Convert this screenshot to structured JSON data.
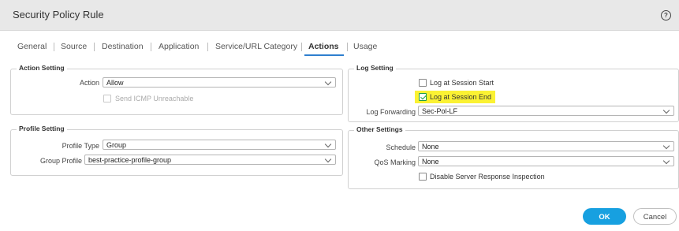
{
  "window": {
    "title": "Security Policy Rule",
    "help_icon": "?"
  },
  "tabs": [
    {
      "label": "General"
    },
    {
      "label": "Source"
    },
    {
      "label": "Destination"
    },
    {
      "label": "Application"
    },
    {
      "label": "Service/URL Category"
    },
    {
      "label": "Actions",
      "active": true
    },
    {
      "label": "Usage"
    }
  ],
  "action_setting": {
    "legend": "Action Setting",
    "action_label": "Action",
    "action_value": "Allow",
    "send_icmp_label": "Send ICMP Unreachable",
    "send_icmp_checked": false,
    "send_icmp_disabled": true
  },
  "profile_setting": {
    "legend": "Profile Setting",
    "profile_type_label": "Profile Type",
    "profile_type_value": "Group",
    "group_profile_label": "Group Profile",
    "group_profile_value": "best-practice-profile-group"
  },
  "log_setting": {
    "legend": "Log Setting",
    "log_start_label": "Log at Session Start",
    "log_start_checked": false,
    "log_end_label": "Log at Session End",
    "log_end_checked": true,
    "highlight_color": "#fbf233",
    "log_forwarding_label": "Log Forwarding",
    "log_forwarding_value": "Sec-Pol-LF"
  },
  "other_settings": {
    "legend": "Other Settings",
    "schedule_label": "Schedule",
    "schedule_value": "None",
    "qos_label": "QoS Marking",
    "qos_value": "None",
    "disable_sri_label": "Disable Server Response Inspection",
    "disable_sri_checked": false
  },
  "buttons": {
    "ok": "OK",
    "cancel": "Cancel"
  },
  "colors": {
    "accent": "#17a0e0",
    "tab_underline": "#2f7fcf",
    "check": "#1f9c4a"
  }
}
